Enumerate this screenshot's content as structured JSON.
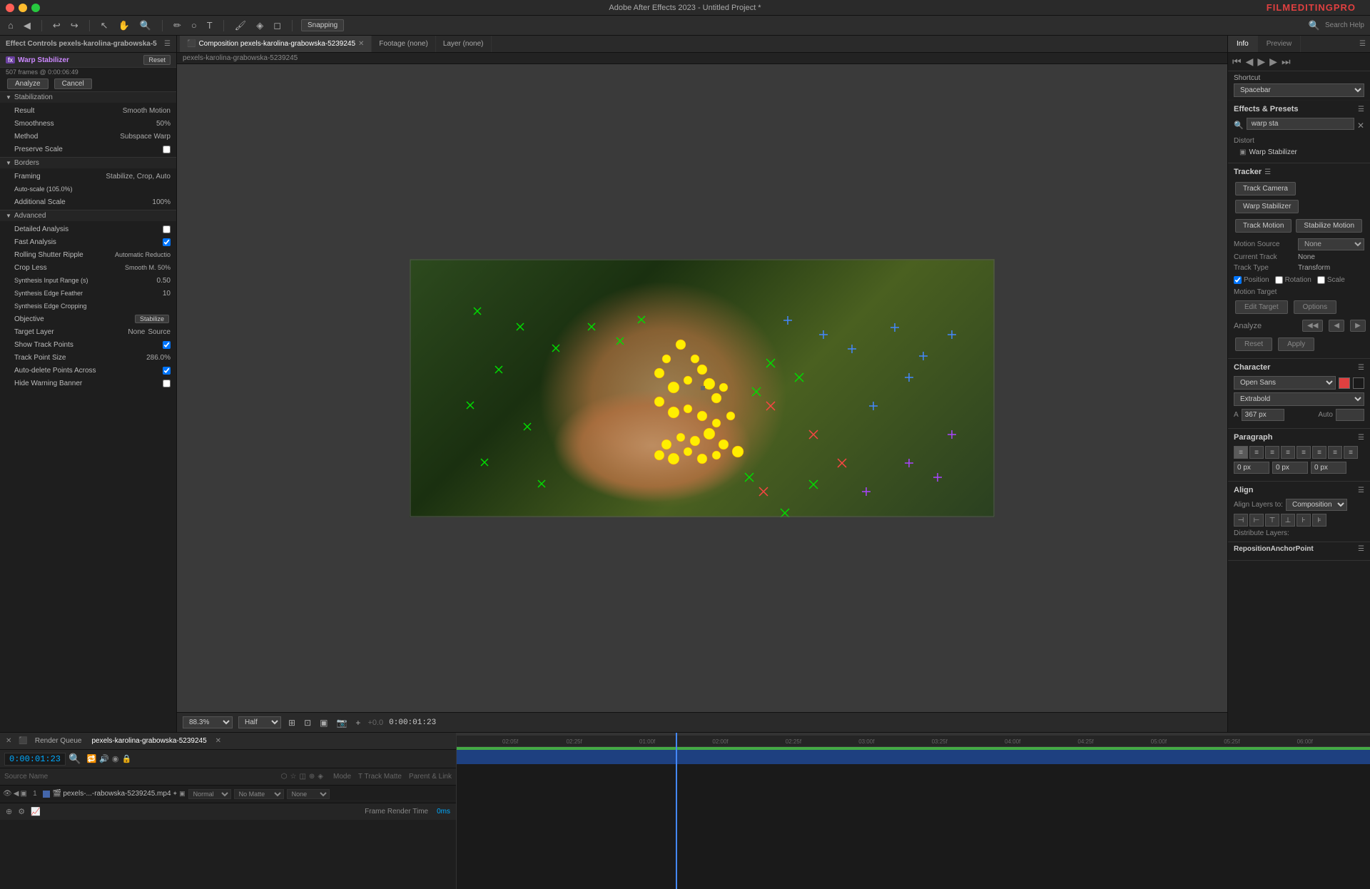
{
  "app": {
    "title": "Adobe After Effects 2023 - Untitled Project *",
    "brand": "FILMEDITING",
    "brand_pro": "PRO"
  },
  "toolbar": {
    "snapping": "Snapping",
    "search_help": "Search Help"
  },
  "left_panel": {
    "title": "Effect Controls pexels-karolina-grabowska-5",
    "file_name": "pexels-karolina-grabowska-5239245",
    "frames": "507 frames @ 0:00:06:49",
    "analyze_btn": "Analyze",
    "cancel_btn": "Cancel",
    "reset_btn": "Reset",
    "sections": {
      "warp_stabilizer": "Warp Stabilizer",
      "stabilization": "Stabilization",
      "borders": "Borders",
      "advanced": "Advanced"
    },
    "stabilization": {
      "result_label": "Result",
      "result_value": "Smooth Motion",
      "smoothness_label": "Smoothness",
      "smoothness_value": "50%",
      "method_label": "Method",
      "method_value": "Subspace Warp",
      "preserve_scale_label": "Preserve Scale"
    },
    "borders": {
      "framing_label": "Framing",
      "framing_value": "Stabilize, Crop, Auto",
      "autoscale_label": "Auto-scale (105.0%)",
      "additional_scale_label": "Additional Scale",
      "additional_scale_value": "100%"
    },
    "advanced": {
      "detailed_analysis": "Detailed Analysis",
      "fast_analysis": "Fast Analysis",
      "rolling_shutter": "Rolling Shutter Ripple",
      "rolling_value": "Automatic Reductio",
      "crop_less_label": "Crop Less",
      "crop_less_value": "Smooth M. 50%",
      "synthesis_input_label": "Synthesis Input Range (s)",
      "synthesis_input_value": "0.50",
      "synthesis_edge_feather": "Synthesis Edge Feather",
      "synthesis_edge_value": "10",
      "synthesis_edge_crop": "Synthesis Edge Cropping",
      "objective_label": "Objective",
      "objective_btn": "Stabilize",
      "target_layer_label": "Target Layer",
      "target_layer_none": "None",
      "target_layer_source": "Source",
      "show_track_points": "Show Track Points",
      "track_point_size": "Track Point Size",
      "track_point_value": "286.0%",
      "auto_delete": "Auto-delete Points Across",
      "hide_warning": "Hide Warning Banner"
    }
  },
  "tabs": {
    "composition": "Composition pexels-karolina-grabowska-5239245",
    "footage": "Footage (none)",
    "layer": "Layer (none)"
  },
  "breadcrumb": "pexels-karolina-grabowska-5239245",
  "viewport": {
    "zoom": "88.3%",
    "quality": "Half",
    "timecode": "0:00:01:23"
  },
  "right_panel": {
    "info_tab": "Info",
    "preview_tab": "Preview",
    "shortcut_label": "Shortcut",
    "shortcut_value": "Spacebar",
    "effects_presets_title": "Effects & Presets",
    "search_placeholder": "warp sta",
    "effects_items": [
      {
        "name": "Warp Stabilizer",
        "category": "Distort"
      }
    ],
    "tracker_title": "Tracker",
    "track_camera_btn": "Track Camera",
    "warp_stabilizer_btn": "Warp Stabilizer",
    "track_motion_btn": "Track Motion",
    "stabilize_motion_btn": "Stabilize Motion",
    "motion_source_label": "Motion Source",
    "motion_source_value": "None",
    "current_track_label": "Current Track",
    "current_track_value": "None",
    "track_type_label": "Track Type",
    "track_type_value": "Transform",
    "position_label": "Position",
    "rotation_label": "Rotation",
    "scale_label": "Scale",
    "motion_target_label": "Motion Target",
    "edit_target_btn": "Edit Target",
    "options_btn": "Options",
    "analyze_label": "Analyze",
    "analyze_left_left": "◀◀",
    "analyze_left": "◀",
    "analyze_right": "▶",
    "analyze_right_right": "▶▶",
    "reset_btn": "Reset",
    "apply_btn": "Apply",
    "character_title": "Character",
    "font_name": "Open Sans",
    "font_style": "Extrabold",
    "font_size": "367 px",
    "font_size_auto": "Auto",
    "para_title": "Paragraph",
    "align_layers_label": "Align Layers to:",
    "align_layers_value": "Composition",
    "align_section": "Align",
    "distribute_label": "Distribute Layers:",
    "reposition_label": "RepositionAnchorPoint"
  },
  "timeline": {
    "tab": "pexels-karolina-grabowska-5239245",
    "timecode": "0:00:01:23",
    "layer_name": "pexels-...-rabowska-5239245.mp4",
    "mode": "Normal",
    "matte": "No Matte",
    "parent": "None",
    "marks": [
      "02:05f",
      "02:25f",
      "01:00f",
      "02:00f",
      "02:25f",
      "03:00f",
      "03:25f",
      "04:00f",
      "04:25f",
      "05:00f",
      "05:25f",
      "06:00f"
    ],
    "render_time": "Frame Render Time",
    "render_value": "0ms"
  },
  "colors": {
    "accent_blue": "#4488ff",
    "accent_purple": "#6a3fa0",
    "accent_cyan": "#00aaff",
    "track_blue": "#1e4080",
    "green_bar": "#44aa44",
    "red_swatch": "#e04040"
  }
}
